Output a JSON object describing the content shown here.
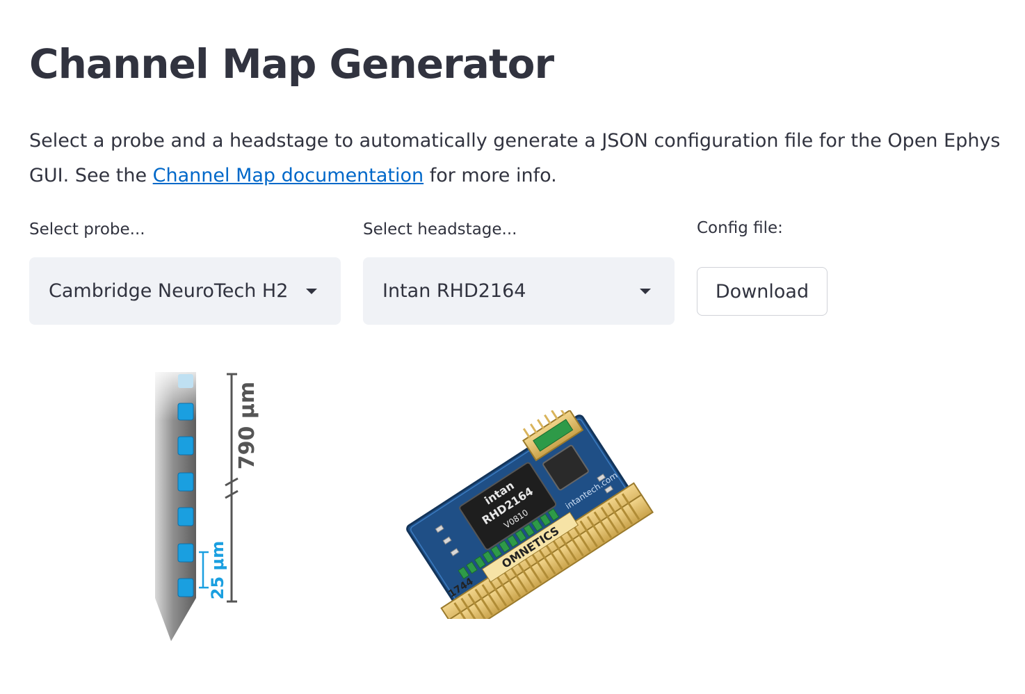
{
  "page": {
    "title": "Channel Map Generator",
    "description_before_link": "Select a probe and a headstage to automatically generate a JSON configuration file for the Open Ephys GUI. See the ",
    "link_text": "Channel Map documentation",
    "description_after_link": " for more info."
  },
  "controls": {
    "probe_label": "Select probe...",
    "probe_value": "Cambridge NeuroTech H2",
    "headstage_label": "Select headstage...",
    "headstage_value": "Intan RHD2164",
    "config_label": "Config file:",
    "download_label": "Download"
  },
  "probe_image": {
    "length_label": "790 μm",
    "spacing_label": "25 μm"
  },
  "headstage_image": {
    "chip_brand": "intan",
    "chip_model": "RHD2164",
    "chip_code": "V0810",
    "connector_brand": "OMNETICS",
    "connector_code": "1744",
    "board_text": "intantech.com"
  },
  "colors": {
    "accent_link": "#0068c9",
    "select_bg": "#f0f2f6",
    "text": "#31333f"
  }
}
